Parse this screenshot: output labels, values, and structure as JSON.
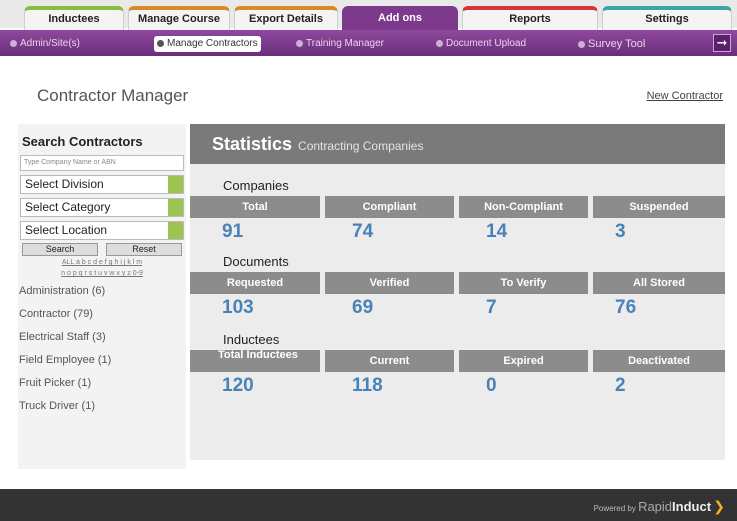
{
  "tabs": [
    {
      "label": "Inductees",
      "x": 0
    },
    {
      "label": "Manage Course",
      "x": 1
    },
    {
      "label": "Export Details",
      "x": 2
    },
    {
      "label": "Add ons",
      "x": 3
    },
    {
      "label": "Reports",
      "x": 4
    },
    {
      "label": "Settings",
      "x": 5
    }
  ],
  "subnav": [
    "Admin/Site(s)",
    "Manage Contractors",
    "Training Manager",
    "Document Upload",
    "Survey Tool"
  ],
  "exit_icon": "exit-arrow-icon",
  "page_title": "Contractor Manager",
  "new_contractor_link": "New Contractor",
  "sidebar": {
    "title": "Search Contractors",
    "search_placeholder": "Type Company Name or ABN",
    "selects": [
      "Select Division",
      "Select Category",
      "Select Location"
    ],
    "search_button": "Search",
    "reset_button": "Reset",
    "alpha_line1": "ALL a b c d e f g h i j k l m",
    "alpha_line2": "n o p q r s t u v w x y z 0-9",
    "categories": [
      "Administration (6)",
      "Contractor (79)",
      "Electrical Staff (3)",
      "Field Employee (1)",
      "Fruit Picker (1)",
      "Truck Driver (1)"
    ]
  },
  "stats": {
    "title": "Statistics",
    "subtitle": "Contracting Companies",
    "groups": [
      {
        "label": "Companies",
        "headers": [
          "Total",
          "Compliant",
          "Non-Compliant",
          "Suspended"
        ],
        "values": [
          "91",
          "74",
          "14",
          "3"
        ]
      },
      {
        "label": "Documents",
        "headers": [
          "Requested",
          "Verified",
          "To Verify",
          "All Stored"
        ],
        "values": [
          "103",
          "69",
          "7",
          "76"
        ]
      },
      {
        "label": "Inductees",
        "headers": [
          "Total Inductees",
          "Current",
          "Expired",
          "Deactivated"
        ],
        "values": [
          "120",
          "118",
          "0",
          "2"
        ]
      }
    ]
  },
  "footer": {
    "powered_by": "Powered by",
    "brand_light": "Rapid",
    "brand_bold": "Induct"
  },
  "colors": {
    "accent_purple": "#7d3a8c",
    "value_blue": "#4a82b8",
    "select_green": "#9cc452"
  }
}
